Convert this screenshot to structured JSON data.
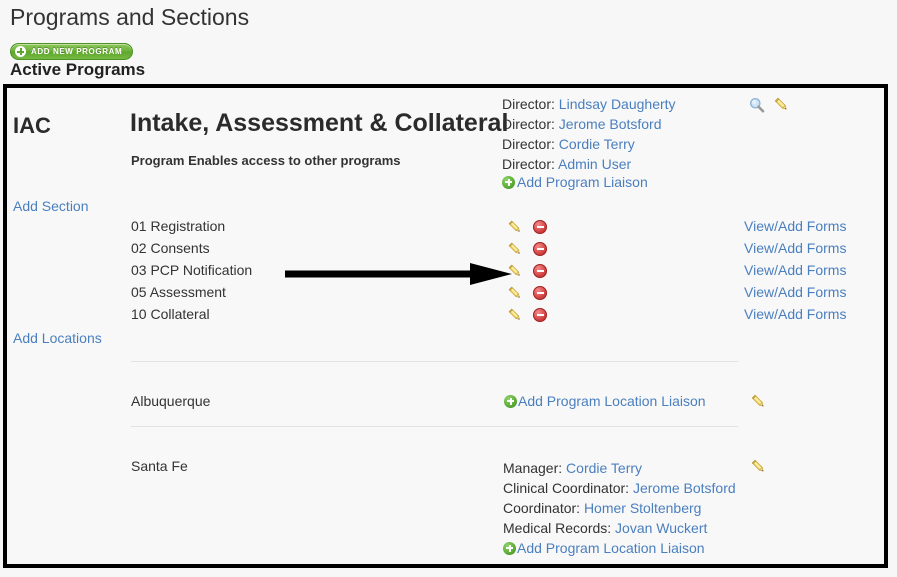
{
  "header": {
    "page_title": "Programs and Sections",
    "add_new_program_label": "Add New Program",
    "active_programs_label": "Active Programs"
  },
  "program": {
    "code": "IAC",
    "name": "Intake, Assessment & Collateral",
    "subtitle": "Program Enables access to other programs",
    "add_section_label": "Add Section",
    "add_locations_label": "Add Locations",
    "add_program_liaison_label": "Add Program Liaison",
    "staff": [
      {
        "role": "Director:",
        "name": "Lindsay Daugherty"
      },
      {
        "role": "Director:",
        "name": "Jerome Botsford"
      },
      {
        "role": "Director:",
        "name": "Cordie Terry"
      },
      {
        "role": "Director:",
        "name": "Admin User"
      }
    ],
    "header_icons": [
      {
        "icon": "search-icon"
      },
      {
        "icon": "pencil-icon"
      }
    ]
  },
  "sections": [
    {
      "name": "01 Registration",
      "forms_label": "View/Add Forms"
    },
    {
      "name": "02 Consents",
      "forms_label": "View/Add Forms"
    },
    {
      "name": "03 PCP Notification",
      "forms_label": "View/Add Forms"
    },
    {
      "name": "05 Assessment",
      "forms_label": "View/Add Forms"
    },
    {
      "name": "10 Collateral",
      "forms_label": "View/Add Forms"
    }
  ],
  "locations": [
    {
      "name": "Albuquerque",
      "add_liaison_label": "Add Program Location Liaison",
      "staff": []
    },
    {
      "name": "Santa Fe",
      "add_liaison_label": "Add Program Location Liaison",
      "staff": [
        {
          "role": "Manager:",
          "name": "Cordie Terry"
        },
        {
          "role": "Clinical Coordinator:",
          "name": "Jerome Botsford"
        },
        {
          "role": "Coordinator:",
          "name": "Homer Stoltenberg"
        },
        {
          "role": "Medical Records:",
          "name": "Jovan Wuckert"
        }
      ]
    }
  ],
  "annotation": {
    "type": "arrow",
    "points_to": "Add Program Liaison"
  },
  "colors": {
    "link": "#4a7fbf",
    "text": "#333333",
    "panel_border": "#000000",
    "page_background": "#f7f7f7",
    "panel_background": "#f8f8f8",
    "button_green": "#6cb037",
    "delete_red": "#d94b4b",
    "divider": "#e2e2e2"
  }
}
